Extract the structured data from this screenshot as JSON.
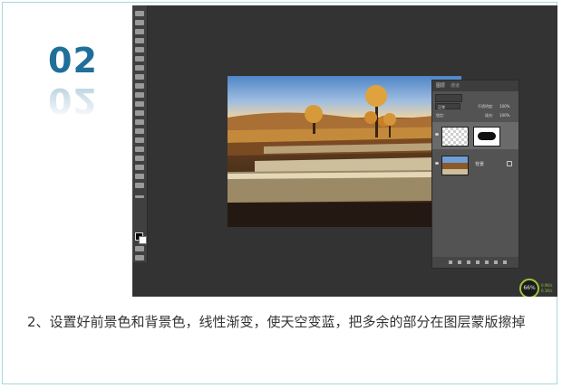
{
  "step": {
    "number": "02"
  },
  "photoshop": {
    "layers_panel": {
      "tabs": [
        "图层",
        "通道"
      ],
      "blend_mode": "正常",
      "opacity_label": "不透明度:",
      "opacity_value": "100%",
      "lock_label": "锁定:",
      "fill_label": "填充:",
      "fill_value": "100%",
      "layers": [
        {
          "name": "",
          "has_mask": true,
          "selected": true
        },
        {
          "name": "背景",
          "has_mask": false,
          "selected": false
        }
      ]
    },
    "perf_meter": {
      "value": "66%",
      "up": "0.9K/s",
      "down": "0.1K/s"
    }
  },
  "caption": "2、设置好前景色和背景色，线性渐变，使天空变蓝，把多余的部分在图层蒙版擦掉",
  "colors": {
    "accent": "#1f6f99",
    "border": "#a9d6dc",
    "ps_bg": "#333333",
    "panel": "#535353"
  }
}
